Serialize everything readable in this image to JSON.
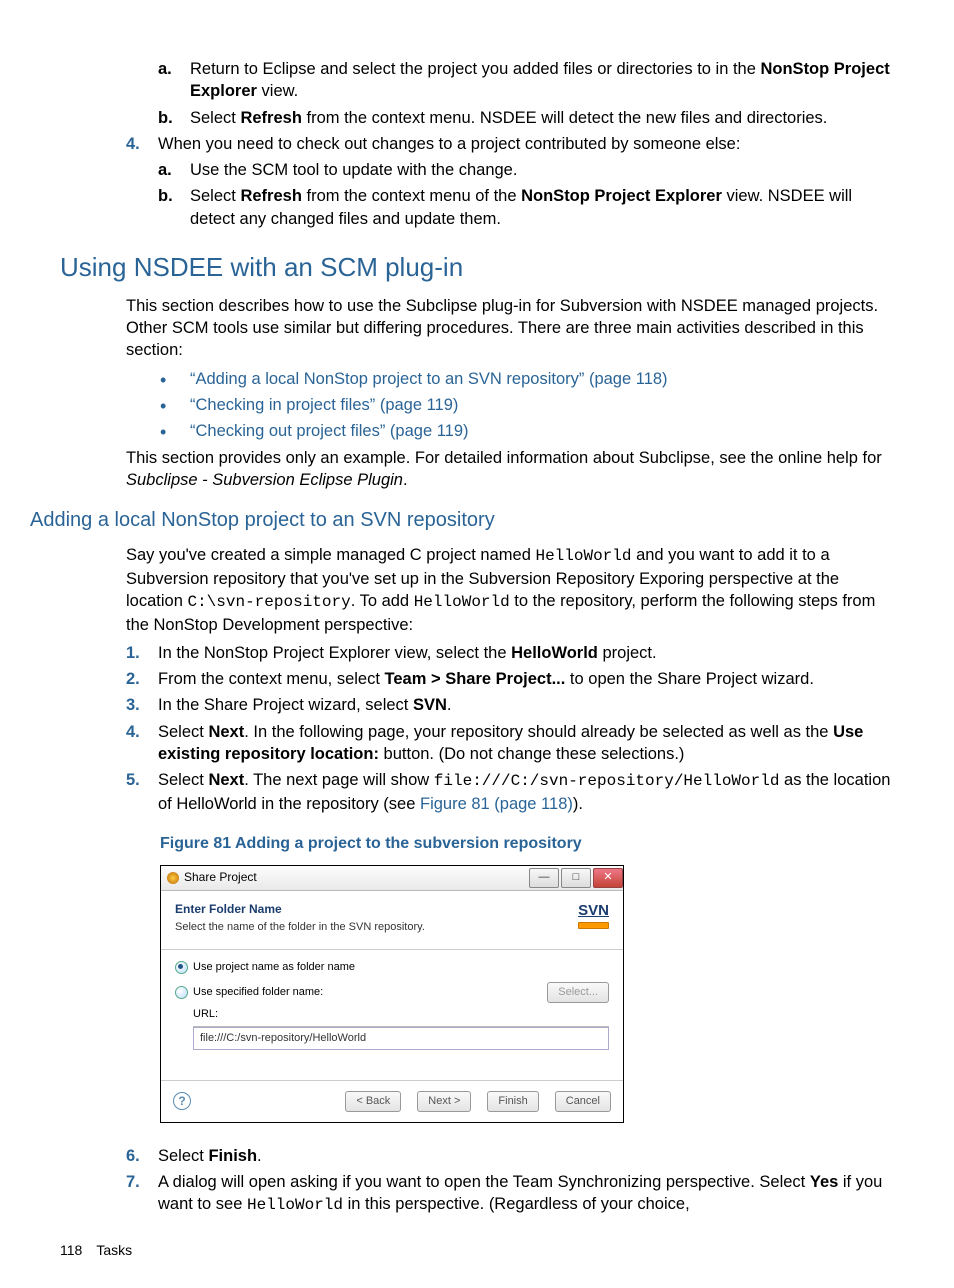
{
  "topSublist": {
    "a": {
      "pre": "Return to Eclipse and select the project you added files or directories to in the ",
      "bold": "NonStop Project Explorer",
      "post": " view."
    },
    "b": {
      "pre": "Select ",
      "bold": "Refresh",
      "post": " from the context menu. NSDEE will detect the new files and directories."
    }
  },
  "item4": {
    "num": "4.",
    "text": "When you need to check out changes to a project contributed by someone else:",
    "a": "Use the SCM tool to update with the change.",
    "b": {
      "pre": "Select ",
      "bold1": "Refresh",
      "mid": " from the context menu of the ",
      "bold2": "NonStop Project Explorer",
      "post": " view. NSDEE will detect any changed files and update them."
    }
  },
  "h2": "Using NSDEE with an SCM plug-in",
  "introPara": "This section describes how to use the Subclipse plug-in for Subversion with NSDEE managed projects. Other SCM tools use similar but differing procedures. There are three main activities described in this section:",
  "bullets": [
    "“Adding a local NonStop project to an SVN repository” (page 118)",
    "“Checking in project files” (page 119)",
    "“Checking out project files” (page 119)"
  ],
  "closingPara": {
    "pre": "This section provides only an example. For detailed information about Subclipse, see the online help for ",
    "italic": "Subclipse - Subversion Eclipse Plugin",
    "post": "."
  },
  "h3": "Adding a local NonStop project to an SVN repository",
  "svnIntro": {
    "pre": "Say you've created a simple managed C project named ",
    "mono1": "HelloWorld",
    "mid1": " and you want to add it to a Subversion repository that you've set up in the Subversion Repository Exporing perspective at the location ",
    "mono2": "C:\\svn-repository",
    "mid2": ". To add ",
    "mono3": "HelloWorld",
    "post": " to the repository, perform the following steps from the NonStop Development perspective:"
  },
  "steps": {
    "s1": {
      "num": "1.",
      "pre": "In the NonStop Project Explorer view, select the ",
      "bold": "HelloWorld",
      "post": " project."
    },
    "s2": {
      "num": "2.",
      "pre": "From the context menu, select ",
      "bold": "Team > Share Project...",
      "post": " to open the Share Project wizard."
    },
    "s3": {
      "num": "3.",
      "pre": "In the Share Project wizard, select ",
      "bold": "SVN",
      "post": "."
    },
    "s4": {
      "num": "4.",
      "pre": "Select ",
      "bold1": "Next",
      "mid": ". In the following page, your repository should already be selected as well as the ",
      "bold2": "Use existing repository location:",
      "post": " button. (Do not change these selections.)"
    },
    "s5": {
      "num": "5.",
      "pre": "Select ",
      "bold": "Next",
      "mid": ". The next page will show ",
      "mono": "file:///C:/svn-repository/HelloWorld",
      "post1": " as the location of HelloWorld in the repository (see ",
      "link": "Figure 81 (page 118)",
      "post2": ")."
    }
  },
  "figCaption": "Figure 81 Adding a project to the subversion repository",
  "dialog": {
    "title": "Share Project",
    "hdrTitle": "Enter Folder Name",
    "hdrSub": "Select the name of the folder in the SVN repository.",
    "badge": "SVN",
    "radio1": "Use project name as folder name",
    "radio2": "Use specified folder name:",
    "selectBtn": "Select...",
    "urlLabel": "URL:",
    "urlValue": "file:///C:/svn-repository/HelloWorld",
    "back": "< Back",
    "next": "Next >",
    "finish": "Finish",
    "cancel": "Cancel"
  },
  "step6": {
    "num": "6.",
    "pre": "Select ",
    "bold": "Finish",
    "post": "."
  },
  "step7": {
    "num": "7.",
    "pre": "A dialog will open asking if you want to open the Team Synchronizing perspective. Select ",
    "bold": "Yes",
    "mid": " if you want to see ",
    "mono": "HelloWorld",
    "post": " in this perspective. (Regardless of your choice,"
  },
  "footer": {
    "page": "118",
    "section": "Tasks"
  }
}
